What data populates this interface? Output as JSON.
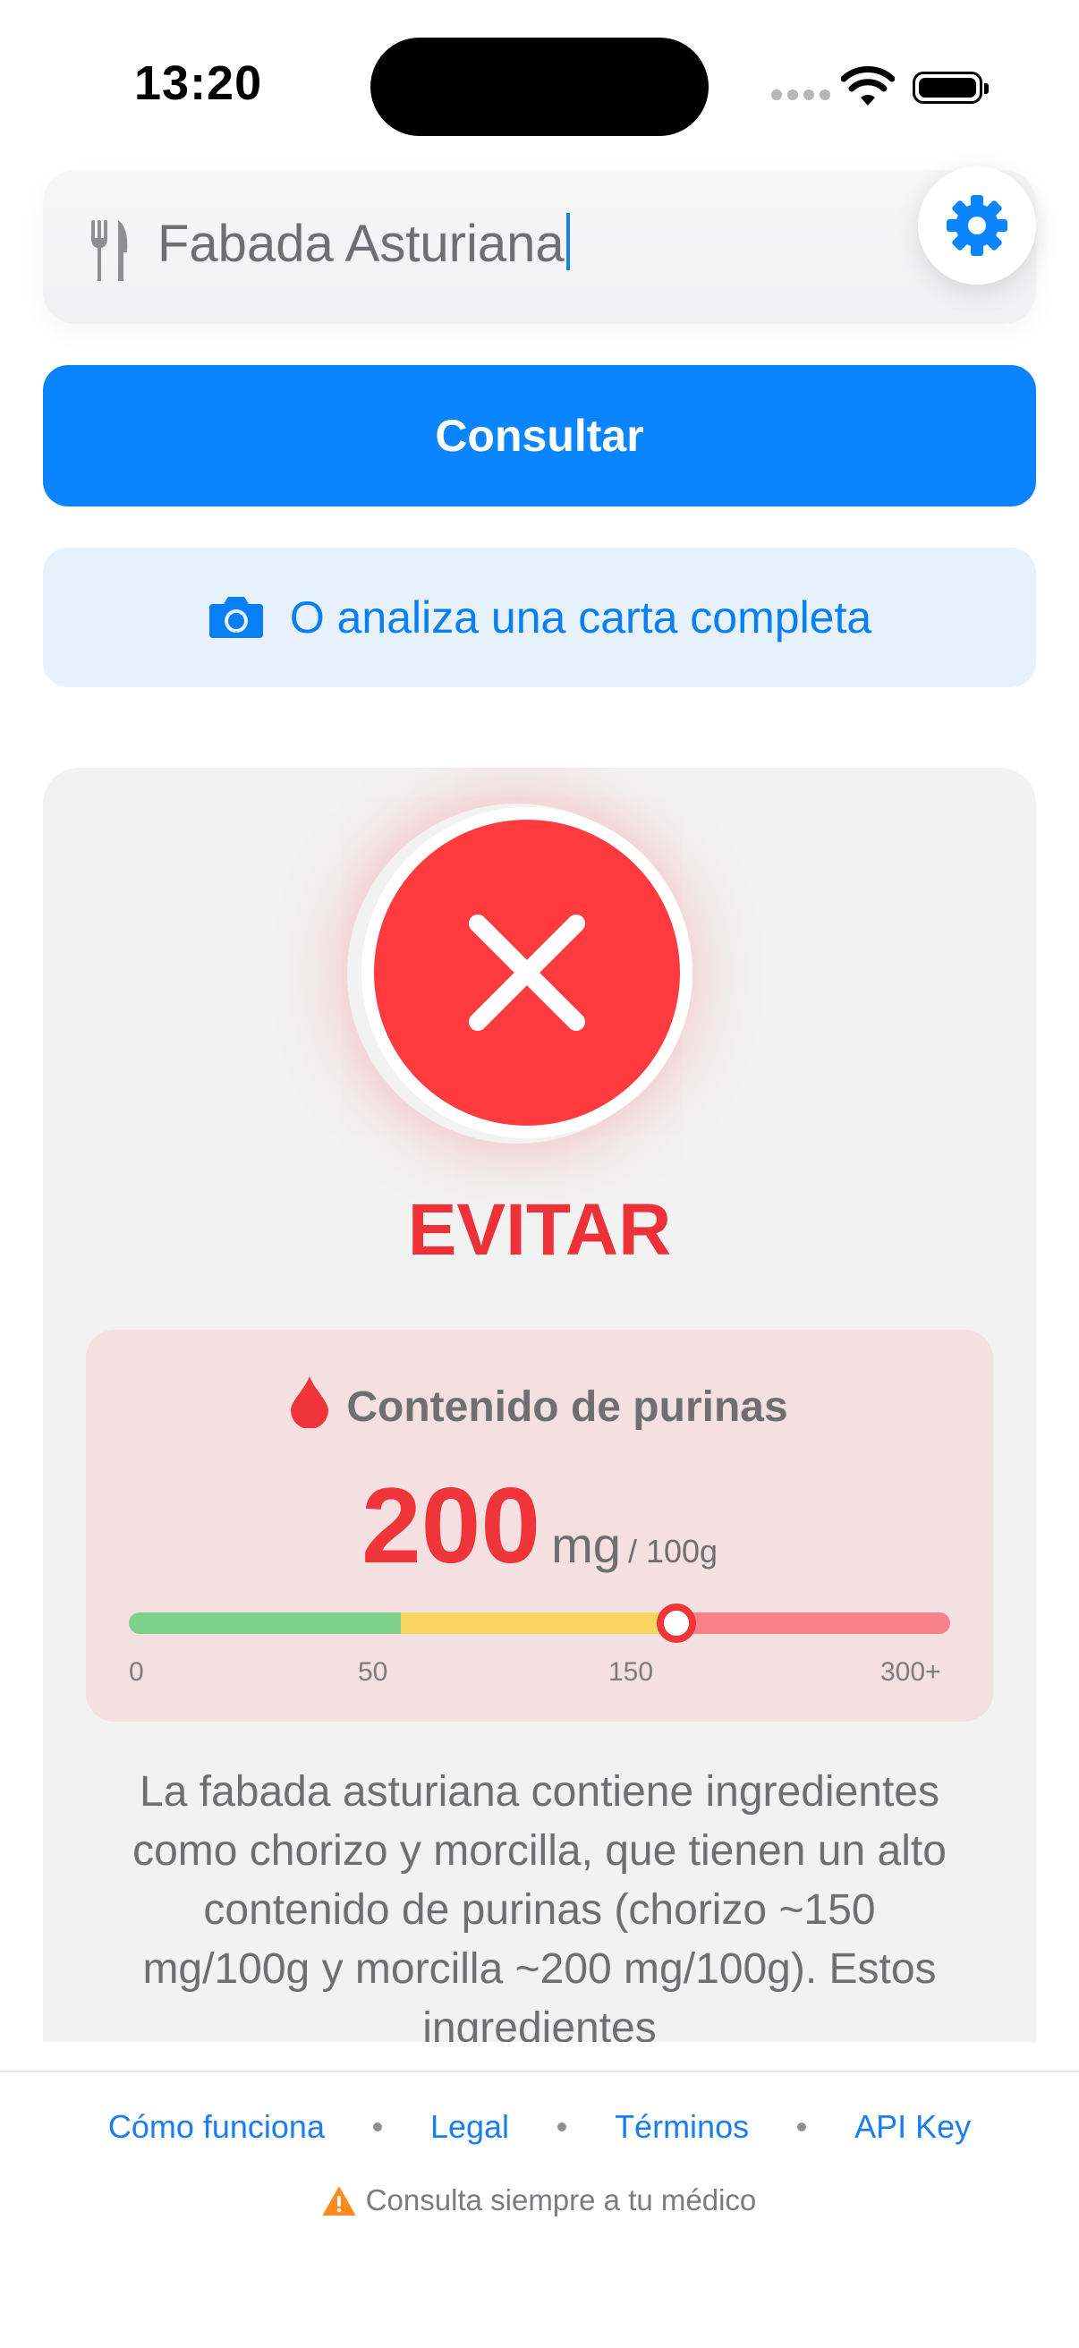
{
  "status_bar": {
    "time": "13:20"
  },
  "search": {
    "value": "Fabada Asturiana"
  },
  "actions": {
    "consult_label": "Consultar",
    "analyze_menu_label": "O analiza una carta completa"
  },
  "result": {
    "verdict": "EVITAR",
    "purine_title": "Contenido de purinas",
    "purine_value": "200",
    "purine_unit": "mg",
    "purine_per": "/ 100g",
    "scale_ticks": [
      "0",
      "50",
      "150",
      "300+"
    ],
    "scale_level_fraction": 0.667,
    "description": "La fabada asturiana contiene ingredientes como chorizo y morcilla, que tienen un alto contenido de purinas (chorizo ~150 mg/100g y morcilla ~200 mg/100g). Estos ingredientes"
  },
  "footer": {
    "links": [
      "Cómo funciona",
      "Legal",
      "Términos",
      "API Key"
    ],
    "note": "Consulta siempre a tu médico"
  },
  "colors": {
    "accent": "#0a84ff",
    "danger": "#ff3b40",
    "scale_green": "#7fd08b",
    "scale_yellow": "#f8d460",
    "scale_red": "#f6818a"
  },
  "icons": [
    "fork-knife-icon",
    "gear-icon",
    "camera-icon",
    "close-x-icon",
    "drop-icon",
    "warning-icon"
  ]
}
